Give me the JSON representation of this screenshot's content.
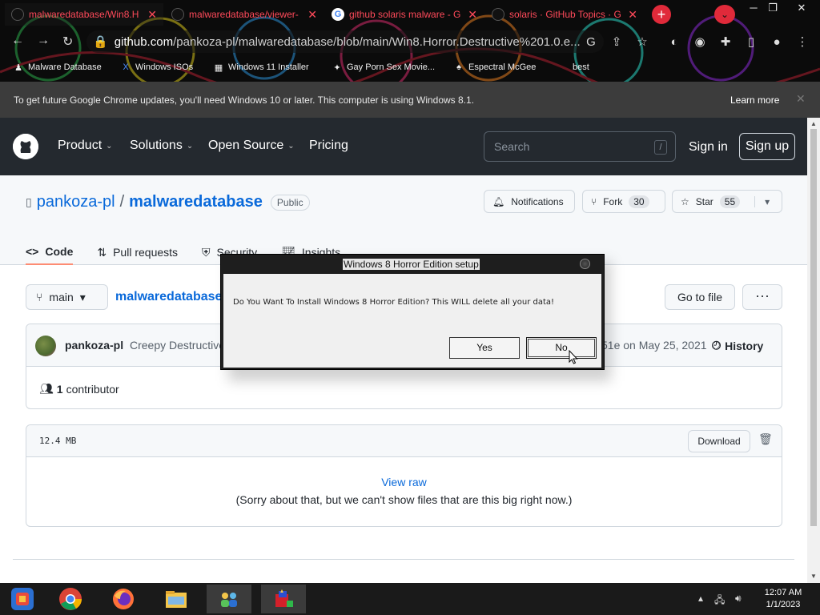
{
  "browser": {
    "tabs": [
      {
        "title": "malwaredatabase/Win8.H",
        "favicon": "github-icon",
        "active": true
      },
      {
        "title": "malwaredatabase/viewer-",
        "favicon": "github-icon",
        "active": false
      },
      {
        "title": "github solaris malware - G",
        "favicon": "google-icon",
        "active": false
      },
      {
        "title": "solaris · GitHub Topics · G",
        "favicon": "github-icon",
        "active": false
      }
    ],
    "new_tab_label": "+",
    "url_host": "github.com",
    "url_path": "/pankoza-pl/malwaredatabase/blob/main/Win8.Horror.Destructive%201.0.e...",
    "bookmarks": [
      "Malware Database",
      "Windows ISOs",
      "Windows 11 Installer",
      "Gay Porn Sex Movie...",
      "Espectral McGee",
      "best"
    ],
    "theme_accent": "#e02a3a"
  },
  "infobar": {
    "message": "To get future Google Chrome updates, you'll need Windows 10 or later. This computer is using Windows 8.1.",
    "learn_more": "Learn more"
  },
  "github": {
    "nav": [
      "Product",
      "Solutions",
      "Open Source",
      "Pricing"
    ],
    "search_placeholder": "Search",
    "search_hotkey": "/",
    "sign_in": "Sign in",
    "sign_up": "Sign up",
    "repo_owner": "pankoza-pl",
    "repo_sep": "/",
    "repo_name": "malwaredatabase",
    "visibility": "Public",
    "notifications_label": "Notifications",
    "fork_label": "Fork",
    "fork_count": "30",
    "star_label": "Star",
    "star_count": "55",
    "tabs": [
      "Code",
      "Pull requests",
      "Security",
      "Insights"
    ],
    "branch": "main",
    "breadcrumb_repo": "malwaredatabase",
    "go_to_file": "Go to file",
    "more": "···",
    "commit_author": "pankoza-pl",
    "commit_message": "Creepy Destructive",
    "commit_meta": "51e on May 25, 2021",
    "history": "History",
    "contributor_count": "1",
    "contributor_label": "contributor",
    "file_size": "12.4 MB",
    "download": "Download",
    "view_raw": "View raw",
    "too_big_msg": "(Sorry about that, but we can't show files that are this big right now.)"
  },
  "dialog": {
    "title": "Windows 8 Horror Edition setup",
    "message": "Do You Want To Install Windows 8 Horror Edition? This WILL delete all your data!",
    "yes": "Yes",
    "no": "No"
  },
  "taskbar": {
    "time": "12:07 AM",
    "date": "1/1/2023",
    "apps": [
      "start-icon",
      "chrome-icon",
      "firefox-icon",
      "file-explorer-icon",
      "people-app-icon",
      "setup-app-icon"
    ]
  }
}
